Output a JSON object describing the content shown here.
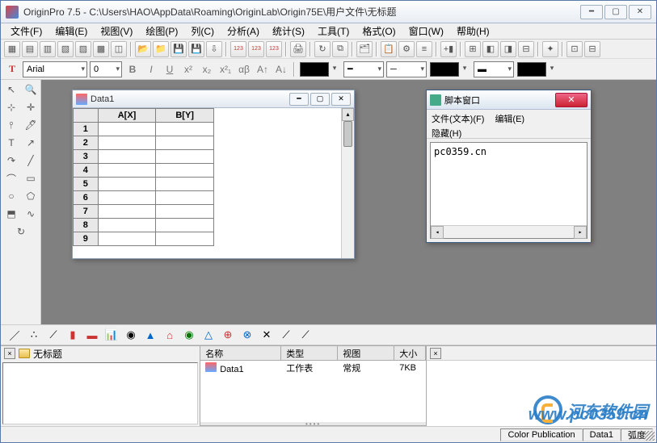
{
  "title": "OriginPro 7.5 - C:\\Users\\HAO\\AppData\\Roaming\\OriginLab\\Origin75E\\用户文件\\无标题",
  "menu": [
    "文件(F)",
    "编辑(E)",
    "视图(V)",
    "绘图(P)",
    "列(C)",
    "分析(A)",
    "统计(S)",
    "工具(T)",
    "格式(O)",
    "窗口(W)",
    "帮助(H)"
  ],
  "font": {
    "family": "Arial",
    "size": "0"
  },
  "data_window": {
    "title": "Data1",
    "cols": [
      "A[X]",
      "B[Y]"
    ],
    "rows": [
      "1",
      "2",
      "3",
      "4",
      "5",
      "6",
      "7",
      "8",
      "9"
    ]
  },
  "script_window": {
    "title": "脚本窗口",
    "menu1": [
      "文件(文本)(F)",
      "编辑(E)"
    ],
    "menu2": [
      "隐藏(H)"
    ],
    "content": "pc0359.cn"
  },
  "project_tree": {
    "root": "无标题"
  },
  "file_list": {
    "headers": {
      "name": "名称",
      "type": "类型",
      "view": "视图",
      "size": "大小"
    },
    "row": {
      "name": "Data1",
      "type": "工作表",
      "view": "常规",
      "size": "7KB"
    }
  },
  "status": {
    "color_pub": "Color Publication",
    "data": "Data1",
    "rad": "弧度"
  },
  "watermark": {
    "text": "河东软件园",
    "url": "www.pc0359.cn"
  }
}
